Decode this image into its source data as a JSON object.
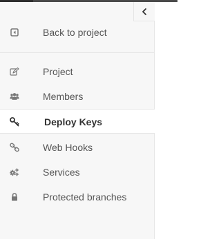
{
  "colors": {
    "sidebar_bg": "#f7f7f7",
    "active_bg": "#ffffff",
    "text": "#555555",
    "active_text": "#333333",
    "icon": "#777777",
    "active_icon": "#333333",
    "border": "#e5e5e5"
  },
  "toggle": {
    "icon": "chevron-left-icon"
  },
  "back": {
    "label": "Back to project",
    "icon": "arrow-left-square-icon"
  },
  "nav": {
    "items": [
      {
        "label": "Project",
        "icon": "edit-icon",
        "active": false
      },
      {
        "label": "Members",
        "icon": "users-icon",
        "active": false
      },
      {
        "label": "Deploy Keys",
        "icon": "key-icon",
        "active": true
      },
      {
        "label": "Web Hooks",
        "icon": "link-icon",
        "active": false
      },
      {
        "label": "Services",
        "icon": "cogs-icon",
        "active": false
      },
      {
        "label": "Protected branches",
        "icon": "lock-icon",
        "active": false
      }
    ]
  }
}
